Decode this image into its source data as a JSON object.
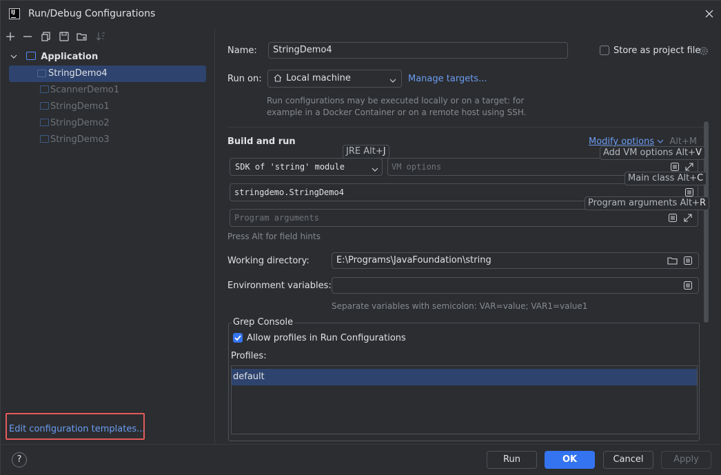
{
  "window": {
    "title": "Run/Debug Configurations"
  },
  "toolbar": {
    "icons": [
      "add-icon",
      "remove-icon",
      "copy-icon",
      "save-icon",
      "new-folder-icon",
      "sort-icon"
    ]
  },
  "tree": {
    "root_label": "Application",
    "items": [
      {
        "label": "StringDemo4",
        "selected": true
      },
      {
        "label": "ScannerDemo1"
      },
      {
        "label": "StringDemo1"
      },
      {
        "label": "StringDemo2"
      },
      {
        "label": "StringDemo3"
      }
    ]
  },
  "edit_templates_link": "Edit configuration templates...",
  "form": {
    "name_label": "Name:",
    "name_value": "StringDemo4",
    "store_project_label": "Store as project file",
    "run_on_label": "Run on:",
    "run_on_value": "Local machine",
    "manage_targets_link": "Manage targets...",
    "run_on_hint_1": "Run configurations may be executed locally or on a target: for",
    "run_on_hint_2": "example in a Docker Container or on a remote host using SSH.",
    "build_run_title": "Build and run",
    "modify_options_link": "Modify options",
    "modify_options_shortcut": "Alt+M",
    "sdk_value": "SDK of 'string' module",
    "vm_options_placeholder": "VM options",
    "main_class_value": "stringdemo.StringDemo4",
    "program_args_placeholder": "Program arguments",
    "alt_hint": "Press Alt for field hints",
    "working_dir_label": "Working directory:",
    "working_dir_value": "E:\\Programs\\JavaFoundation\\string",
    "env_vars_label": "Environment variables:",
    "env_vars_value": "",
    "env_hint": "Separate variables with semicolon: VAR=value; VAR1=value1"
  },
  "tooltips": {
    "jre": {
      "text": "JRE Alt+",
      "key": "J"
    },
    "add_vm": {
      "text": "Add VM options Alt+",
      "key": "V"
    },
    "main_class": {
      "text": "Main class Alt+",
      "key": "C"
    },
    "program_args": {
      "text": "Program arguments Alt+",
      "key": "R"
    }
  },
  "grep_console": {
    "title": "Grep Console",
    "allow_profiles_label": "Allow profiles in Run Configurations",
    "allow_profiles_checked": true,
    "profiles_label": "Profiles:",
    "profiles": [
      "default"
    ]
  },
  "buttons": {
    "help": "?",
    "run": "Run",
    "ok": "OK",
    "cancel": "Cancel",
    "apply": "Apply"
  },
  "colors": {
    "accent": "#3574f0",
    "link": "#6c9cf2",
    "selection": "#2e436e",
    "highlight_box": "#e55b5b"
  }
}
